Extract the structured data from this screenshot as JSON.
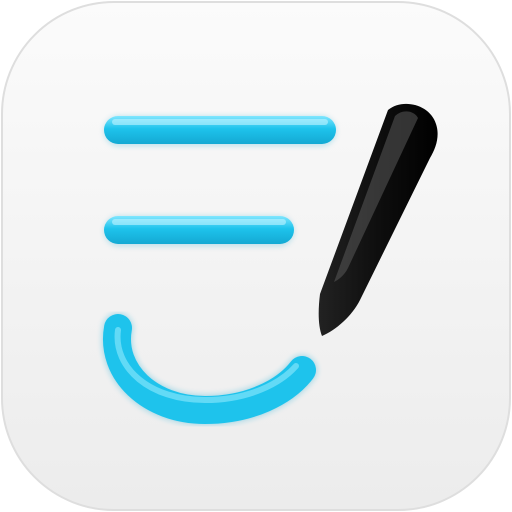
{
  "icon": {
    "name": "notes-with-pen-app-icon",
    "tile_color_top": "#fbfbfb",
    "tile_color_bottom": "#ececec",
    "tile_edge_color": "#dedede",
    "accent_color": "#1ec3ec",
    "accent_highlight": "#7fe6ff",
    "pen_color": "#0e0e0e",
    "pen_highlight": "#5a5a5a"
  }
}
